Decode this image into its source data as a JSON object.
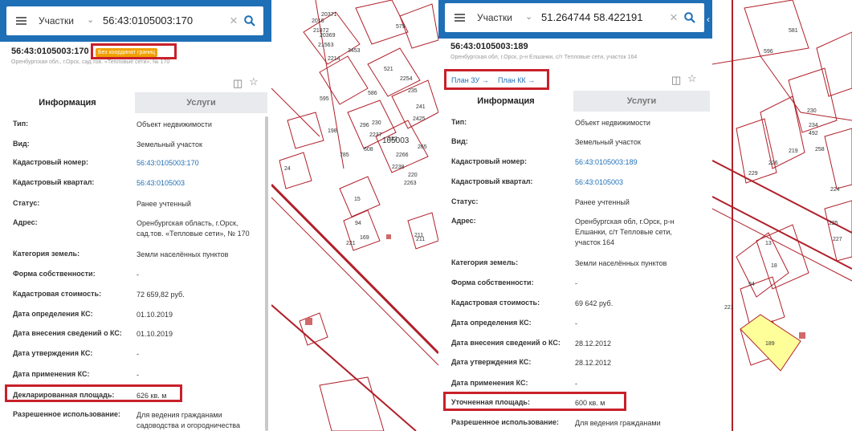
{
  "left": {
    "layer_label": "Участки",
    "query": "56:43:0105003:170",
    "cad_title": "56:43:0105003:170",
    "badge": "Без координат границ",
    "address_line": "Оренбургская обл., г.Орск, сад.тов. «Тепловые сети», № 170",
    "tabs": [
      "Информация",
      "Услуги"
    ],
    "rows": [
      {
        "label": "Тип:",
        "value": "Объект недвижимости"
      },
      {
        "label": "Вид:",
        "value": "Земельный участок"
      },
      {
        "label": "Кадастровый номер:",
        "value": "56:43:0105003:170",
        "link": true
      },
      {
        "label": "Кадастровый квартал:",
        "value": "56:43:0105003",
        "link": true
      },
      {
        "label": "Статус:",
        "value": "Ранее учтенный"
      },
      {
        "label": "Адрес:",
        "value": "Оренбургская область, г.Орск, сад.тов. «Тепловые сети», № 170"
      },
      {
        "label": "Категория земель:",
        "value": "Земли населённых пунктов"
      },
      {
        "label": "Форма собственности:",
        "value": "-"
      },
      {
        "label": "Кадастровая стоимость:",
        "value": "72 659,82 руб."
      },
      {
        "label": "Дата определения КС:",
        "value": "01.10.2019"
      },
      {
        "label": "Дата внесения сведений о КС:",
        "value": "01.10.2019"
      },
      {
        "label": "Дата утверждения КС:",
        "value": "-"
      },
      {
        "label": "Дата применения КС:",
        "value": "-"
      },
      {
        "label": "Декларированная площадь:",
        "value": "626 кв. м"
      },
      {
        "label": "Разрешенное использование:",
        "value": "Для ведения гражданами садоводства и огородничества"
      }
    ]
  },
  "right": {
    "layer_label": "Участки",
    "query": "51.264744 58.422191",
    "cad_title": "56:43:0105003:189",
    "address_line": "Оренбургская обл, г.Орск, р-н Елшанки, с/т Тепловые сети, участок 164",
    "plan_zu": "План ЗУ →",
    "plan_kk": "План КК →",
    "tabs": [
      "Информация",
      "Услуги"
    ],
    "rows": [
      {
        "label": "Тип:",
        "value": "Объект недвижимости"
      },
      {
        "label": "Вид:",
        "value": "Земельный участок"
      },
      {
        "label": "Кадастровый номер:",
        "value": "56:43:0105003:189",
        "link": true
      },
      {
        "label": "Кадастровый квартал:",
        "value": "56:43:0105003",
        "link": true
      },
      {
        "label": "Статус:",
        "value": "Ранее учтенный"
      },
      {
        "label": "Адрес:",
        "value": "Оренбургская обл, г.Орск, р-н Елшанки, с/т Тепловые сети, участок 164"
      },
      {
        "label": "Категория земель:",
        "value": "Земли населённых пунктов"
      },
      {
        "label": "Форма собственности:",
        "value": "-"
      },
      {
        "label": "Кадастровая стоимость:",
        "value": "69 642 руб."
      },
      {
        "label": "Дата определения КС:",
        "value": "-"
      },
      {
        "label": "Дата внесения сведений о КС:",
        "value": "28.12.2012"
      },
      {
        "label": "Дата утверждения КС:",
        "value": "28.12.2012"
      },
      {
        "label": "Дата применения КС:",
        "value": "-"
      },
      {
        "label": "Уточненная площадь:",
        "value": "600 кв. м"
      },
      {
        "label": "Разрешенное использование:",
        "value": "Для ведения гражданами"
      }
    ]
  },
  "map_left": {
    "parcels": [
      "579",
      "20371",
      "2016",
      "21872",
      "21563",
      "20369",
      "2214",
      "3453",
      "586",
      "521",
      "2254",
      "235",
      "241",
      "2425",
      "265",
      "296",
      "230",
      "2237",
      "608",
      "595",
      "198",
      "785",
      "227",
      "2266",
      "2238",
      "220",
      "2263",
      "24",
      "15",
      "94",
      "221",
      "169",
      "211",
      "211",
      "105003"
    ]
  },
  "map_right": {
    "parcels": [
      "581",
      "596",
      "229",
      "230",
      "234",
      "492",
      "258",
      "219",
      "226",
      "224",
      "225",
      "227",
      "13",
      "18",
      "94",
      "221",
      "189"
    ]
  },
  "colors": {
    "accent": "#1f6fb6",
    "parcel_line": "#b0202a",
    "highlight": "#c8202a",
    "badge": "#f0a000",
    "selected_parcel": "#ffff99"
  }
}
